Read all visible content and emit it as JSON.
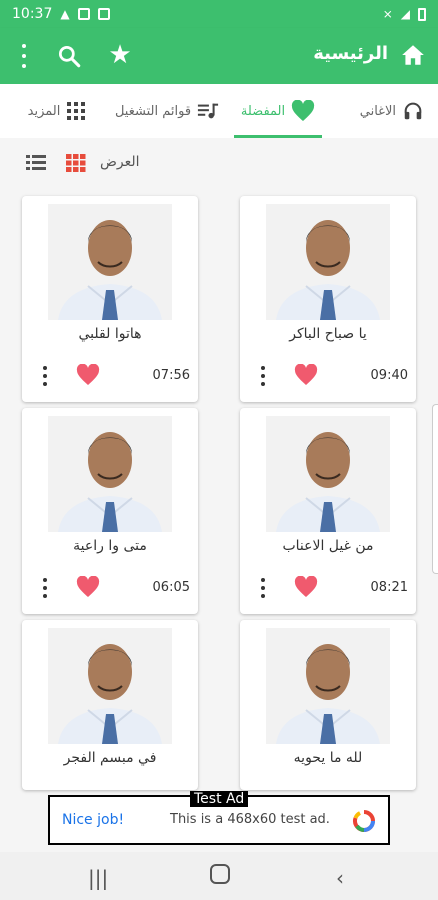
{
  "status": {
    "time": "10:37",
    "icons": [
      "alert-icon",
      "image-icon",
      "mail-icon"
    ],
    "right_icons": [
      "silent-icon",
      "signal-icon",
      "battery-icon"
    ]
  },
  "appbar": {
    "title": "الرئيسية"
  },
  "tabs": [
    {
      "label": "الاغاني",
      "icon": "headphones-icon"
    },
    {
      "label": "المفضلة",
      "icon": "heart-icon",
      "active": true
    },
    {
      "label": "قوائم التشغيل",
      "icon": "playlist-icon"
    },
    {
      "label": "المزيد",
      "icon": "grid-icon"
    }
  ],
  "view": {
    "label": "العرض"
  },
  "songs": [
    {
      "name": "يا صباح الباكر",
      "duration": "09:40"
    },
    {
      "name": "هاتوا لقلبي",
      "duration": "07:56"
    },
    {
      "name": "من غيل الاعناب",
      "duration": "08:21"
    },
    {
      "name": "متى وا راعية",
      "duration": "06:05"
    },
    {
      "name": "لله ما يحويه",
      "duration": ""
    },
    {
      "name": "في مبسم الفجر",
      "duration": ""
    }
  ],
  "ad": {
    "tag": "Test Ad",
    "nice": "Nice job!",
    "text": "This is a 468x60 test ad."
  },
  "colors": {
    "accent": "#3dbf6e",
    "heart": "#f05a6e"
  }
}
